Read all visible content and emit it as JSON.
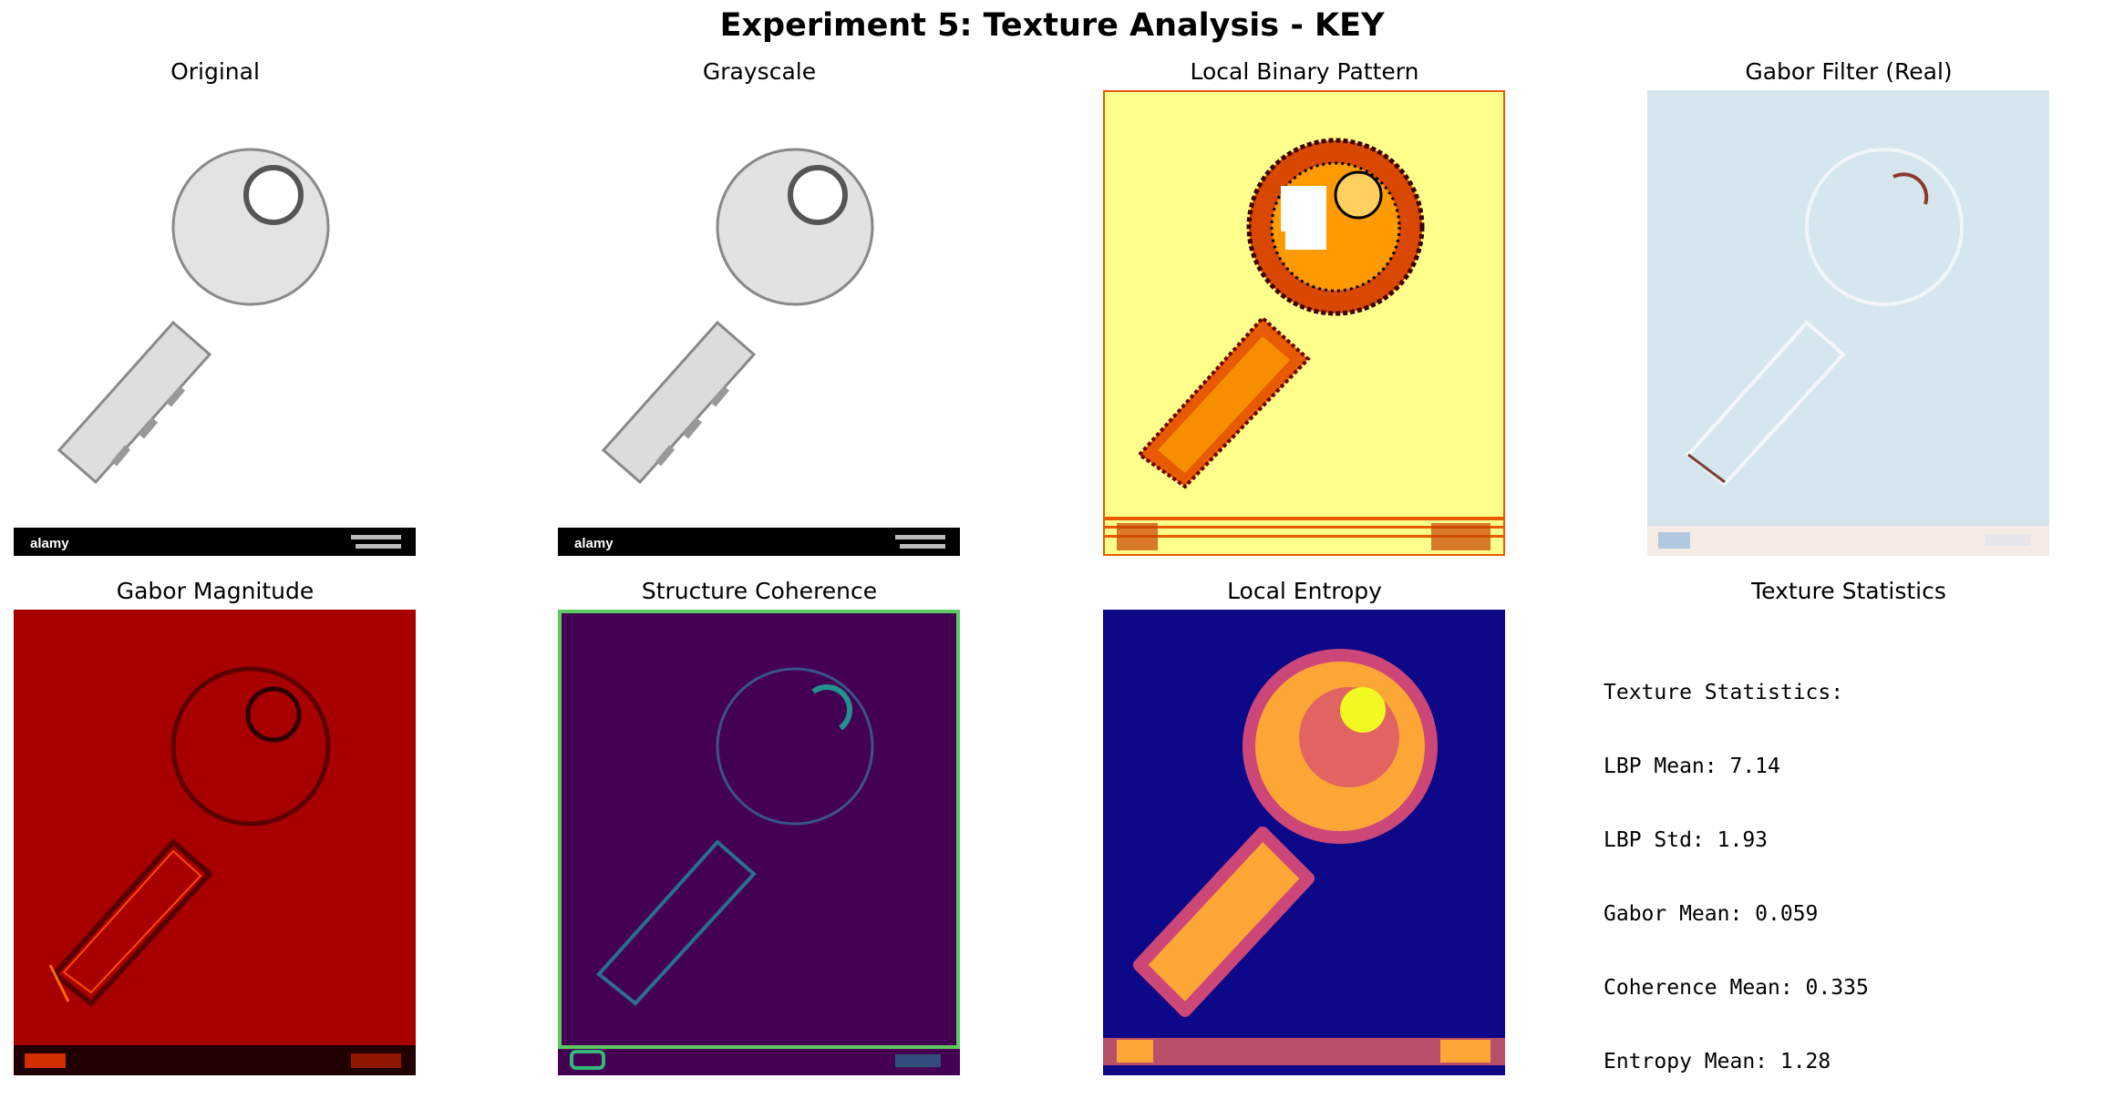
{
  "suptitle": "Experiment 5: Texture Analysis - KEY",
  "panels": [
    {
      "title": "Original",
      "image": "key-photo",
      "watermark": "alamy"
    },
    {
      "title": "Grayscale",
      "image": "key-grayscale",
      "watermark": "alamy"
    },
    {
      "title": "Local Binary Pattern",
      "image": "key-lbp-heatmap"
    },
    {
      "title": "Gabor Filter (Real)",
      "image": "key-gabor-real"
    },
    {
      "title": "Gabor Magnitude",
      "image": "key-gabor-magnitude"
    },
    {
      "title": "Structure Coherence",
      "image": "key-coherence"
    },
    {
      "title": "Local Entropy",
      "image": "key-entropy"
    },
    {
      "title": "Texture Statistics"
    }
  ],
  "stats": {
    "heading": "Texture Statistics:",
    "lines": [
      "LBP Mean: 7.14",
      "LBP Std: 1.93",
      "Gabor Mean: 0.059",
      "Coherence Mean: 0.335",
      "Entropy Mean: 1.28"
    ]
  },
  "colors": {
    "lbp_bg": "#ffff8c",
    "lbp_edge": "#e85a00",
    "gabor_bg": "#d6e6ef",
    "gabor_mag_bg": "#a80000",
    "coherence_bg": "#440154",
    "coherence_edge": "#5ec962",
    "entropy_bg": "#0d0887",
    "entropy_hot": "#fca636"
  }
}
